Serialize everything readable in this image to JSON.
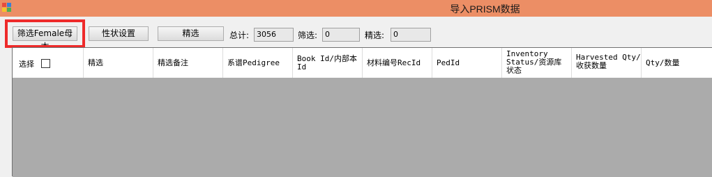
{
  "window": {
    "title": "导入PRISM数据",
    "app_icon": "windows-form-icon"
  },
  "toolbar": {
    "filter_female_label": "筛选Female母本",
    "trait_settings_label": "性状设置",
    "select_label": "精选",
    "total_label": "总计:",
    "total_value": "3056",
    "filtered_label": "筛选:",
    "filtered_value": "0",
    "selected_label": "精选:",
    "selected_value": "0"
  },
  "table": {
    "columns": [
      {
        "label": "选择",
        "has_checkbox": true
      },
      {
        "label": "精选"
      },
      {
        "label": "精选备注"
      },
      {
        "label": "系谱Pedigree"
      },
      {
        "label": "Book Id/内部本\nId"
      },
      {
        "label": "材料编号RecId"
      },
      {
        "label": "PedId"
      },
      {
        "label": "Inventory\nStatus/资源库\n状态"
      },
      {
        "label": "Harvested Qty/\n收获数量"
      },
      {
        "label": "Qty/数量"
      }
    ],
    "rows": []
  },
  "colors": {
    "titlebar": "#ec8e65",
    "highlight": "#ee2a2a",
    "grid_background": "#ababab"
  }
}
